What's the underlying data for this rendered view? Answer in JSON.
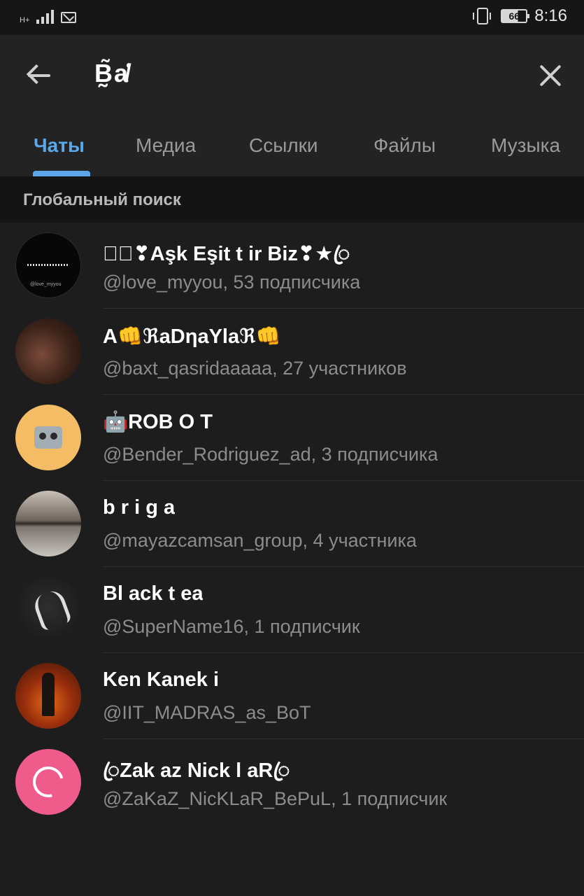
{
  "status_bar": {
    "network": "H+",
    "battery": "66",
    "time": "8:16"
  },
  "header": {
    "search_query": "B̰̃a̸͑"
  },
  "tabs": [
    {
      "label": "Чаты",
      "active": true
    },
    {
      "label": "Медиа",
      "active": false
    },
    {
      "label": "Ссылки",
      "active": false
    },
    {
      "label": "Файлы",
      "active": false
    },
    {
      "label": "Музыка",
      "active": false
    }
  ],
  "section": {
    "title": "Глобальный поиск"
  },
  "results": [
    {
      "title": "★ꦿ❣Aşk Eşit t ir Biz❣★ꦿ",
      "subtitle": "@love_myyou, 53 подписчика"
    },
    {
      "title": "A👊ℜaDηaYlaℜ👊",
      "subtitle": "@baxt_qasridaaaaa, 27 участников"
    },
    {
      "title": "🤖ROB O T",
      "subtitle": "@Bender_Rodriguez_ad, 3 подписчика"
    },
    {
      "title": "b r i g a",
      "subtitle": "@mayazcamsan_group, 4 участника"
    },
    {
      "title": "Bl ack t ea",
      "subtitle": "@SuperName16, 1 подписчик"
    },
    {
      "title": "Ken Kanek i",
      "subtitle": "@IIT_MADRAS_as_BoT"
    },
    {
      "title": "ꦿZak az Nick l aRꦿ",
      "subtitle": "@ZaKaZ_NicKLaR_BePuL, 1 подписчик"
    }
  ],
  "colors": {
    "accent": "#5aa8ea",
    "background": "#1d1d1d",
    "header": "#232323"
  }
}
